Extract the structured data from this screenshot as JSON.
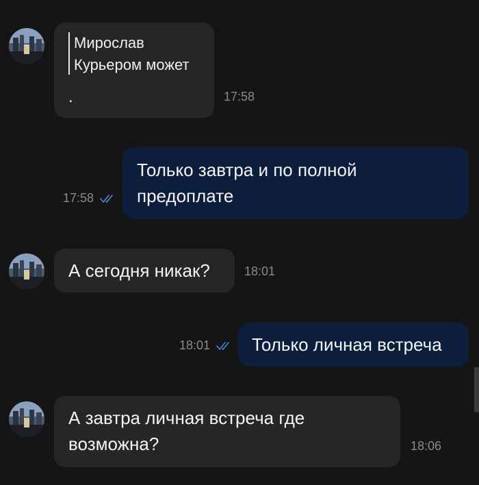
{
  "messages": [
    {
      "direction": "incoming",
      "quote": {
        "author": "Мирослав",
        "text": "Курьером может"
      },
      "text": ".",
      "time": "17:58"
    },
    {
      "direction": "outgoing",
      "lines": [
        "Только завтра и по полной",
        "предоплате"
      ],
      "time": "17:58",
      "status_icon": "double-check-icon"
    },
    {
      "direction": "incoming",
      "text": "А сегодня никак?",
      "time": "18:01"
    },
    {
      "direction": "outgoing",
      "text": "Только личная встреча",
      "time": "18:01",
      "status_icon": "double-check-icon"
    },
    {
      "direction": "incoming",
      "lines": [
        "А завтра личная встреча где",
        "возможна?"
      ],
      "time": "18:06"
    }
  ],
  "colors": {
    "background": "#151515",
    "incoming_bubble": "#262626",
    "outgoing_bubble": "#0c1e3b",
    "read_check": "#4a86d8",
    "timestamp": "#8a8a8a"
  }
}
